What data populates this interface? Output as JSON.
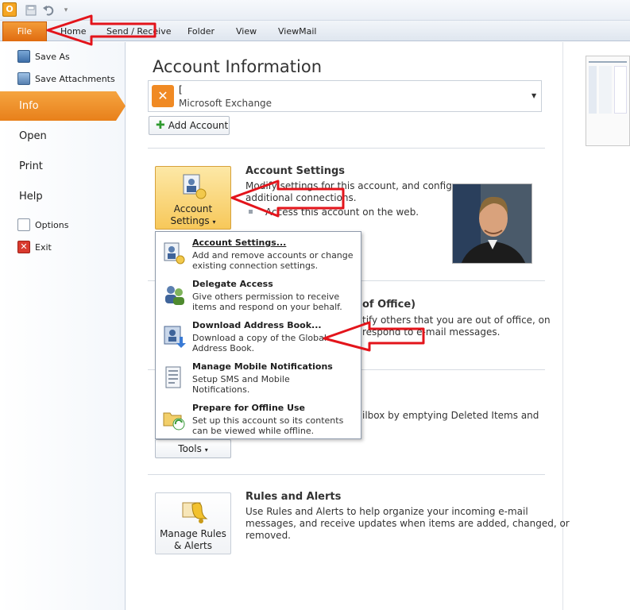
{
  "ribbon": {
    "tabs": {
      "file": "File",
      "home": "Home",
      "send_receive": "Send / Receive",
      "folder": "Folder",
      "view": "View",
      "viewmail": "ViewMail"
    }
  },
  "nav": {
    "save_as": "Save As",
    "save_attachments": "Save Attachments",
    "info": "Info",
    "open": "Open",
    "print": "Print",
    "help": "Help",
    "options": "Options",
    "exit": "Exit"
  },
  "main": {
    "title": "Account Information",
    "account": {
      "name": "[",
      "type": "Microsoft Exchange"
    },
    "add_account": "Add Account",
    "account_settings": {
      "button_line1": "Account",
      "button_line2": "Settings",
      "title": "Account Settings",
      "text_line1": "Modify settings for this account, and configure",
      "text_line2": "additional connections.",
      "bullet": "Access this account on the web."
    },
    "oof": {
      "title_fragment": "of Office)",
      "text_line1": "tify others that you are out of office, on",
      "text_line2": "respond to e-mail messages."
    },
    "cleanup": {
      "text": "ilbox by emptying Deleted Items and",
      "tools": "Tools"
    },
    "rules": {
      "button_line1": "Manage Rules",
      "button_line2": "& Alerts",
      "title": "Rules and Alerts",
      "text_line1": "Use Rules and Alerts to help organize your incoming e-mail",
      "text_line2": "messages, and receive updates when items are added, changed, or",
      "text_line3": "removed."
    }
  },
  "menu": {
    "items": [
      {
        "title": "Account Settings...",
        "desc_line1": "Add and remove accounts or change",
        "desc_line2": "existing connection settings."
      },
      {
        "title": "Delegate Access",
        "desc_line1": "Give others permission to receive",
        "desc_line2": "items and respond on your behalf."
      },
      {
        "title": "Download Address Book...",
        "desc_line1": "Download a copy of the Global",
        "desc_line2": "Address Book."
      },
      {
        "title": "Manage Mobile Notifications",
        "desc_line1": "Setup SMS and Mobile",
        "desc_line2": "Notifications."
      },
      {
        "title": "Prepare for Offline Use",
        "desc_line1": "Set up this account so its contents",
        "desc_line2": "can be viewed while offline."
      }
    ]
  },
  "colors": {
    "accent": "#e8801a",
    "annotation": "#e3141b"
  }
}
